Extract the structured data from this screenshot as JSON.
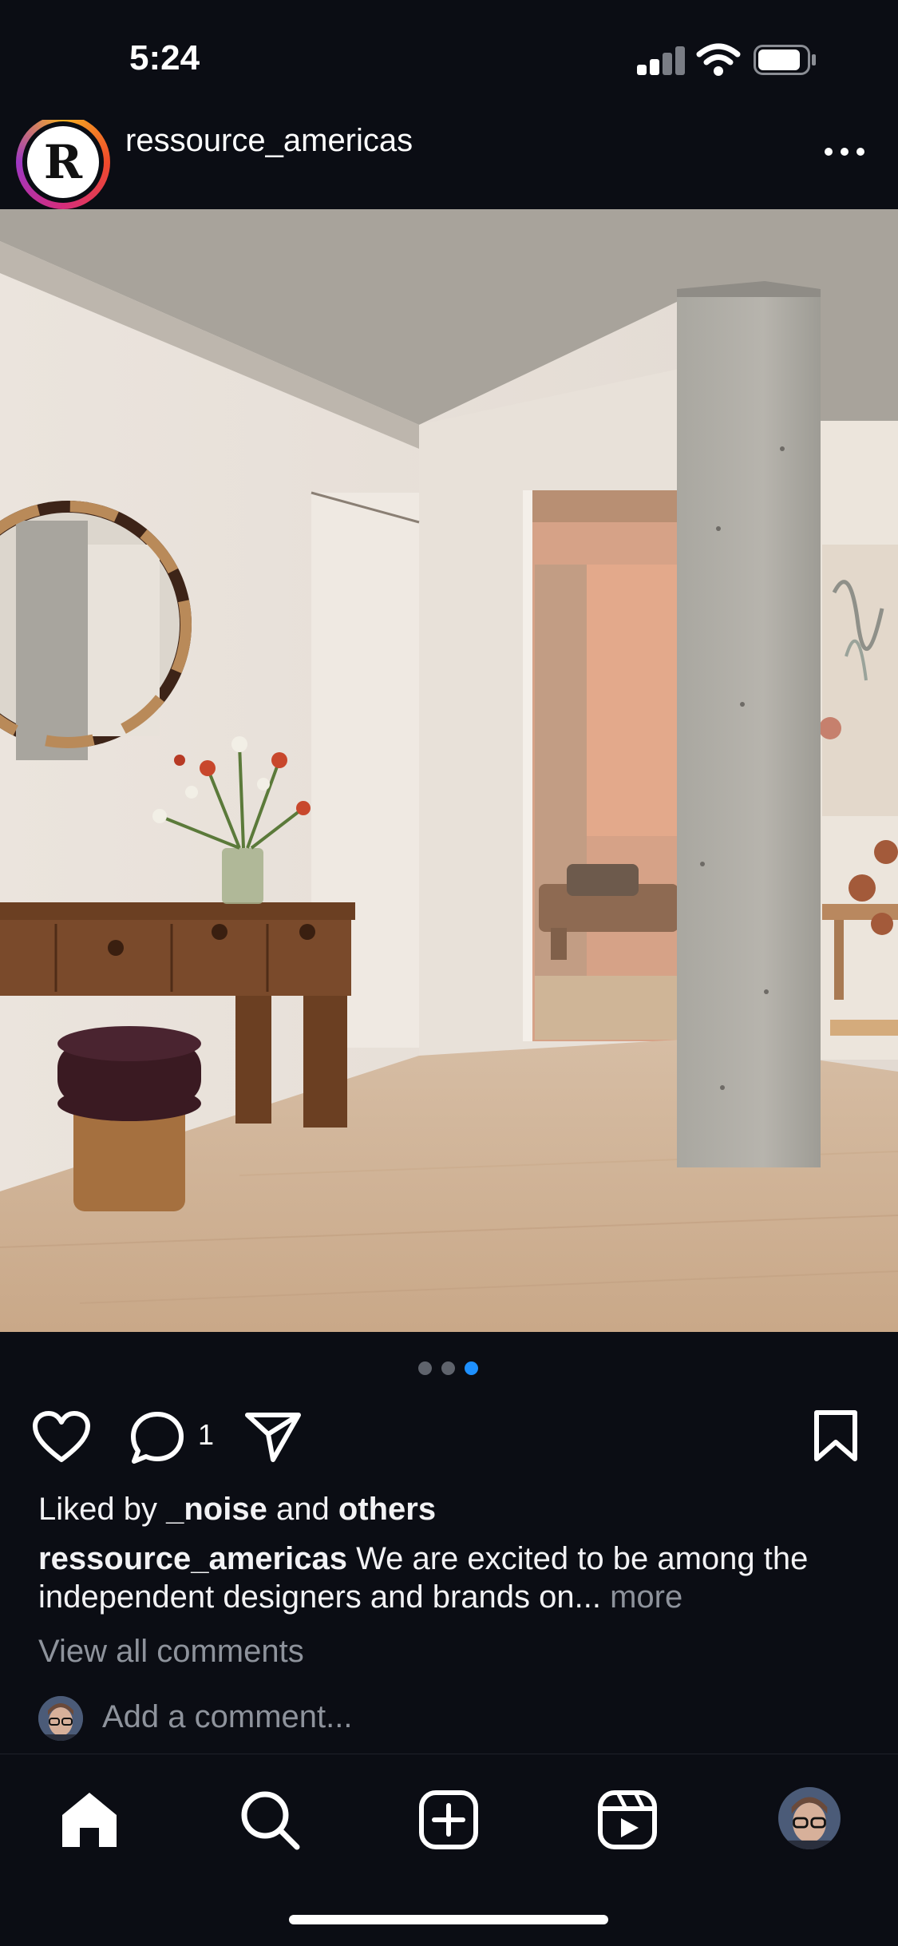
{
  "status_bar": {
    "time": "5:24"
  },
  "post": {
    "username": "ressource_americas",
    "avatar_letter": "R",
    "carousel": {
      "count": 3,
      "active_index": 2
    },
    "comment_count": "1",
    "liked_by": {
      "prefix": "Liked by",
      "user": "_noise",
      "joiner": "and",
      "others": "others"
    },
    "caption": {
      "user": "ressource_americas",
      "text": "We are excited to be among the independent designers and brands on...",
      "more": "more"
    },
    "view_all_comments": "View all comments",
    "add_comment_placeholder": "Add a comment..."
  },
  "tab_bar": {
    "items": [
      "home-icon",
      "search-icon",
      "create-icon",
      "reels-icon",
      "profile-avatar"
    ],
    "active": "home-icon"
  },
  "colors": {
    "background": "#0b0d14",
    "text": "#f2f2f4",
    "secondary_text": "#8e939c",
    "carousel_active": "#1e90ff",
    "carousel_inactive": "#5f636c"
  }
}
